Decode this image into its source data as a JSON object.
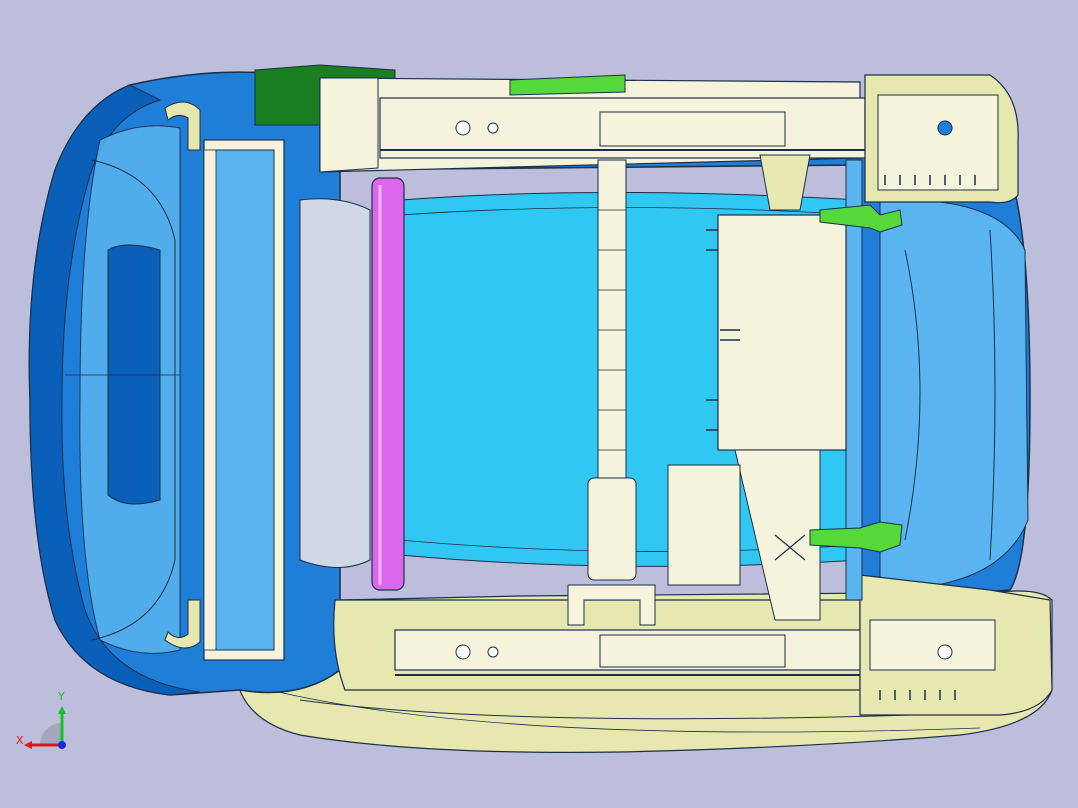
{
  "viewport": {
    "background": "#bcbedc"
  },
  "colors": {
    "body_blue": "#1f7fd8",
    "body_blue_dark": "#0a5fb8",
    "body_blue_light": "#5ab4f0",
    "floor_cyan": "#30c8f2",
    "frame_ivory": "#f6f3dc",
    "trim_yellow": "#e7e8b0",
    "bracket_green": "#55d83a",
    "mount_dark_green": "#1b7f22",
    "tube_magenta": "#dd66ee",
    "edge_line": "#1b2f48"
  },
  "triad": {
    "x_label": "X",
    "y_label": "Y",
    "x_color": "#e01818",
    "y_color": "#18c028",
    "z_color": "#1a2ad0"
  },
  "icons": [
    "axis-triad-icon"
  ]
}
